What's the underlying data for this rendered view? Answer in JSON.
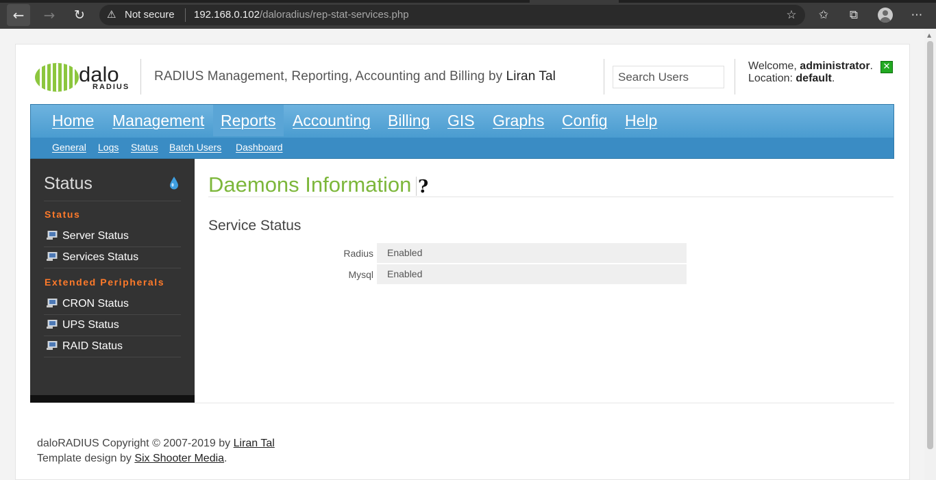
{
  "browser": {
    "security_label": "Not secure",
    "url_host": "192.168.0.102",
    "url_path": "/daloradius/rep-stat-services.php"
  },
  "header": {
    "logo_text": "dalo",
    "logo_subtext": "RADIUS",
    "tagline": "RADIUS Management, Reporting, Accounting and Billing by",
    "tagline_author": "Liran Tal",
    "search_placeholder": "Search Users",
    "welcome_label": "Welcome,",
    "username": "administrator",
    "location_label": "Location:",
    "location": "default"
  },
  "nav": {
    "items": [
      {
        "label": "Home"
      },
      {
        "label": "Management"
      },
      {
        "label": "Reports"
      },
      {
        "label": "Accounting"
      },
      {
        "label": "Billing"
      },
      {
        "label": "GIS"
      },
      {
        "label": "Graphs"
      },
      {
        "label": "Config"
      },
      {
        "label": "Help"
      }
    ],
    "active": "Reports",
    "sub_items": [
      {
        "label": "General"
      },
      {
        "label": "Logs"
      },
      {
        "label": "Status"
      },
      {
        "label": "Batch Users"
      },
      {
        "label": "Dashboard"
      }
    ]
  },
  "sidebar": {
    "title": "Status",
    "sections": [
      {
        "heading": "Status",
        "links": [
          {
            "label": "Server Status"
          },
          {
            "label": "Services Status"
          }
        ]
      },
      {
        "heading": "Extended Peripherals",
        "links": [
          {
            "label": "CRON Status"
          },
          {
            "label": "UPS Status"
          },
          {
            "label": "RAID Status"
          }
        ]
      }
    ]
  },
  "main": {
    "title": "Daemons Information",
    "help_icon": "?",
    "section_heading": "Service Status",
    "services": [
      {
        "name": "Radius",
        "status": "Enabled"
      },
      {
        "name": "Mysql",
        "status": "Enabled"
      }
    ]
  },
  "footer": {
    "line1_prefix": "daloRADIUS Copyright © 2007-2019 by",
    "line1_link": "Liran Tal",
    "line2_prefix": "Template design by",
    "line2_link": "Six Shooter Media",
    "line2_suffix": "."
  },
  "colors": {
    "accent_green": "#7db73b",
    "nav_blue": "#4a9cd0",
    "sidebar_dark": "#333333",
    "section_orange": "#ff7a2a"
  }
}
